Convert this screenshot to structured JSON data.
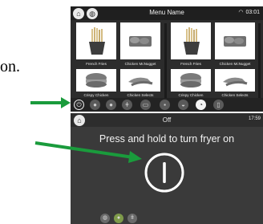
{
  "partial_text": "on.",
  "menu_screen": {
    "title": "Menu Name",
    "time": "03:01",
    "home_icon": "home-icon",
    "globe_icon": "globe-icon",
    "wifi_icon": "wifi-icon",
    "tiles": [
      {
        "label": "French Fries",
        "food": "fries"
      },
      {
        "label": "Chicken McNugget",
        "food": "nuggets"
      },
      {
        "label": "French Fries",
        "food": "fries"
      },
      {
        "label": "Chicken McNugget",
        "food": "nuggets"
      },
      {
        "label": "Crispy Chicken",
        "food": "sandwich"
      },
      {
        "label": "Chicken Selects",
        "food": "strips"
      },
      {
        "label": "Crispy Chicken",
        "food": "sandwich"
      },
      {
        "label": "Chicken Selects",
        "food": "strips"
      }
    ],
    "bottom_icons": [
      "power-icon",
      "drop-icon",
      "drop-icon",
      "thermometer-icon",
      "book-icon",
      "tray-icon",
      "cup-icon",
      "gauge-icon",
      "trash-icon"
    ]
  },
  "off_screen": {
    "title": "Off",
    "time": "17:59",
    "prompt": "Press and hold to turn fryer on",
    "bottom_icons": [
      "globe-icon",
      "drop-icon",
      "thermometer-icon"
    ]
  },
  "colors": {
    "arrow": "#1a9b3c",
    "highlight_ring": "#ffffff",
    "screen_bg": "#2c2c2c"
  }
}
